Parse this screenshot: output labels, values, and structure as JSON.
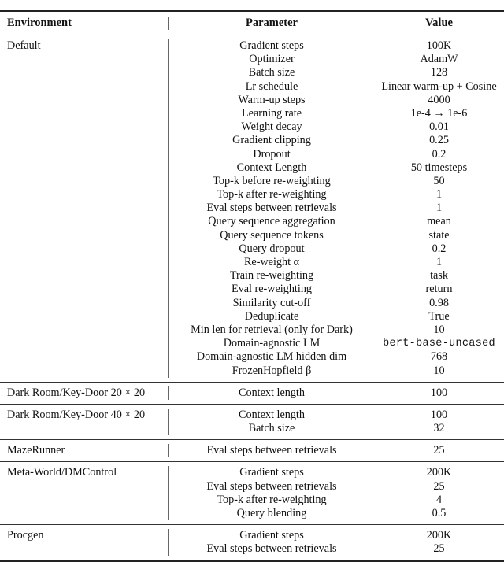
{
  "table": {
    "headers": {
      "environment": "Environment",
      "parameter": "Parameter",
      "value": "Value"
    },
    "sections": [
      {
        "environment": "Default",
        "rows": [
          {
            "parameter": "Gradient steps",
            "value": "100K"
          },
          {
            "parameter": "Optimizer",
            "value": "AdamW"
          },
          {
            "parameter": "Batch size",
            "value": "128"
          },
          {
            "parameter": "Lr schedule",
            "value": "Linear warm-up + Cosine"
          },
          {
            "parameter": "Warm-up steps",
            "value": "4000"
          },
          {
            "parameter": "Learning rate",
            "value": "1e-4 → 1e-6"
          },
          {
            "parameter": "Weight decay",
            "value": "0.01"
          },
          {
            "parameter": "Gradient clipping",
            "value": "0.25"
          },
          {
            "parameter": "Dropout",
            "value": "0.2"
          },
          {
            "parameter": "Context Length",
            "value": "50 timesteps"
          },
          {
            "parameter": "Top-k before re-weighting",
            "value": "50"
          },
          {
            "parameter": "Top-k after re-weighting",
            "value": "1"
          },
          {
            "parameter": "Eval steps between retrievals",
            "value": "1"
          },
          {
            "parameter": "Query sequence aggregation",
            "value": "mean"
          },
          {
            "parameter": "Query sequence tokens",
            "value": "state"
          },
          {
            "parameter": "Query dropout",
            "value": "0.2"
          },
          {
            "parameter": "Re-weight α",
            "value": "1"
          },
          {
            "parameter": "Train re-weighting",
            "value": "task"
          },
          {
            "parameter": "Eval re-weighting",
            "value": "return"
          },
          {
            "parameter": "Similarity cut-off",
            "value": "0.98"
          },
          {
            "parameter": "Deduplicate",
            "value": "True"
          },
          {
            "parameter": "Min len for retrieval (only for Dark)",
            "value": "10"
          },
          {
            "parameter": "Domain-agnostic LM",
            "value": "bert-base-uncased",
            "mono": true
          },
          {
            "parameter": "Domain-agnostic LM hidden dim",
            "value": "768"
          },
          {
            "parameter": "FrozenHopfield β",
            "value": "10"
          }
        ]
      },
      {
        "environment": "Dark Room/Key-Door 20 × 20",
        "rows": [
          {
            "parameter": "Context length",
            "value": "100"
          }
        ]
      },
      {
        "environment": "Dark Room/Key-Door 40 × 20",
        "rows": [
          {
            "parameter": "Context length",
            "value": "100"
          },
          {
            "parameter": "Batch size",
            "value": "32"
          }
        ]
      },
      {
        "environment": "MazeRunner",
        "rows": [
          {
            "parameter": "Eval steps between retrievals",
            "value": "25"
          }
        ]
      },
      {
        "environment": "Meta-World/DMControl",
        "rows": [
          {
            "parameter": "Gradient steps",
            "value": "200K"
          },
          {
            "parameter": "Eval steps between retrievals",
            "value": "25"
          },
          {
            "parameter": "Top-k after re-weighting",
            "value": "4"
          },
          {
            "parameter": "Query blending",
            "value": "0.5"
          }
        ]
      },
      {
        "environment": "Procgen",
        "rows": [
          {
            "parameter": "Gradient steps",
            "value": "200K"
          },
          {
            "parameter": "Eval steps between retrievals",
            "value": "25"
          }
        ]
      }
    ]
  }
}
